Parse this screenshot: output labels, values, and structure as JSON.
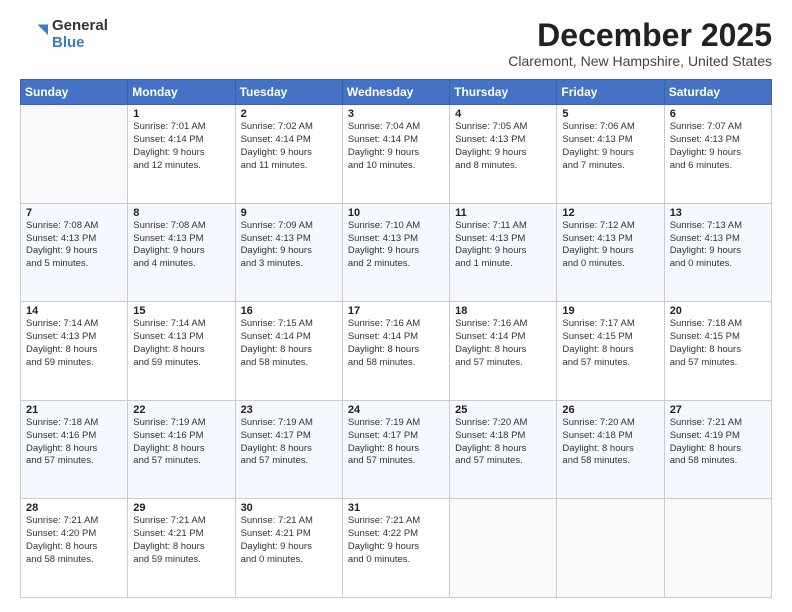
{
  "logo": {
    "general": "General",
    "blue": "Blue"
  },
  "title": {
    "month": "December 2025",
    "location": "Claremont, New Hampshire, United States"
  },
  "days_of_week": [
    "Sunday",
    "Monday",
    "Tuesday",
    "Wednesday",
    "Thursday",
    "Friday",
    "Saturday"
  ],
  "weeks": [
    [
      {
        "day": "",
        "info": ""
      },
      {
        "day": "1",
        "info": "Sunrise: 7:01 AM\nSunset: 4:14 PM\nDaylight: 9 hours\nand 12 minutes."
      },
      {
        "day": "2",
        "info": "Sunrise: 7:02 AM\nSunset: 4:14 PM\nDaylight: 9 hours\nand 11 minutes."
      },
      {
        "day": "3",
        "info": "Sunrise: 7:04 AM\nSunset: 4:14 PM\nDaylight: 9 hours\nand 10 minutes."
      },
      {
        "day": "4",
        "info": "Sunrise: 7:05 AM\nSunset: 4:13 PM\nDaylight: 9 hours\nand 8 minutes."
      },
      {
        "day": "5",
        "info": "Sunrise: 7:06 AM\nSunset: 4:13 PM\nDaylight: 9 hours\nand 7 minutes."
      },
      {
        "day": "6",
        "info": "Sunrise: 7:07 AM\nSunset: 4:13 PM\nDaylight: 9 hours\nand 6 minutes."
      }
    ],
    [
      {
        "day": "7",
        "info": "Sunrise: 7:08 AM\nSunset: 4:13 PM\nDaylight: 9 hours\nand 5 minutes."
      },
      {
        "day": "8",
        "info": "Sunrise: 7:08 AM\nSunset: 4:13 PM\nDaylight: 9 hours\nand 4 minutes."
      },
      {
        "day": "9",
        "info": "Sunrise: 7:09 AM\nSunset: 4:13 PM\nDaylight: 9 hours\nand 3 minutes."
      },
      {
        "day": "10",
        "info": "Sunrise: 7:10 AM\nSunset: 4:13 PM\nDaylight: 9 hours\nand 2 minutes."
      },
      {
        "day": "11",
        "info": "Sunrise: 7:11 AM\nSunset: 4:13 PM\nDaylight: 9 hours\nand 1 minute."
      },
      {
        "day": "12",
        "info": "Sunrise: 7:12 AM\nSunset: 4:13 PM\nDaylight: 9 hours\nand 0 minutes."
      },
      {
        "day": "13",
        "info": "Sunrise: 7:13 AM\nSunset: 4:13 PM\nDaylight: 9 hours\nand 0 minutes."
      }
    ],
    [
      {
        "day": "14",
        "info": "Sunrise: 7:14 AM\nSunset: 4:13 PM\nDaylight: 8 hours\nand 59 minutes."
      },
      {
        "day": "15",
        "info": "Sunrise: 7:14 AM\nSunset: 4:13 PM\nDaylight: 8 hours\nand 59 minutes."
      },
      {
        "day": "16",
        "info": "Sunrise: 7:15 AM\nSunset: 4:14 PM\nDaylight: 8 hours\nand 58 minutes."
      },
      {
        "day": "17",
        "info": "Sunrise: 7:16 AM\nSunset: 4:14 PM\nDaylight: 8 hours\nand 58 minutes."
      },
      {
        "day": "18",
        "info": "Sunrise: 7:16 AM\nSunset: 4:14 PM\nDaylight: 8 hours\nand 57 minutes."
      },
      {
        "day": "19",
        "info": "Sunrise: 7:17 AM\nSunset: 4:15 PM\nDaylight: 8 hours\nand 57 minutes."
      },
      {
        "day": "20",
        "info": "Sunrise: 7:18 AM\nSunset: 4:15 PM\nDaylight: 8 hours\nand 57 minutes."
      }
    ],
    [
      {
        "day": "21",
        "info": "Sunrise: 7:18 AM\nSunset: 4:16 PM\nDaylight: 8 hours\nand 57 minutes."
      },
      {
        "day": "22",
        "info": "Sunrise: 7:19 AM\nSunset: 4:16 PM\nDaylight: 8 hours\nand 57 minutes."
      },
      {
        "day": "23",
        "info": "Sunrise: 7:19 AM\nSunset: 4:17 PM\nDaylight: 8 hours\nand 57 minutes."
      },
      {
        "day": "24",
        "info": "Sunrise: 7:19 AM\nSunset: 4:17 PM\nDaylight: 8 hours\nand 57 minutes."
      },
      {
        "day": "25",
        "info": "Sunrise: 7:20 AM\nSunset: 4:18 PM\nDaylight: 8 hours\nand 57 minutes."
      },
      {
        "day": "26",
        "info": "Sunrise: 7:20 AM\nSunset: 4:18 PM\nDaylight: 8 hours\nand 58 minutes."
      },
      {
        "day": "27",
        "info": "Sunrise: 7:21 AM\nSunset: 4:19 PM\nDaylight: 8 hours\nand 58 minutes."
      }
    ],
    [
      {
        "day": "28",
        "info": "Sunrise: 7:21 AM\nSunset: 4:20 PM\nDaylight: 8 hours\nand 58 minutes."
      },
      {
        "day": "29",
        "info": "Sunrise: 7:21 AM\nSunset: 4:21 PM\nDaylight: 8 hours\nand 59 minutes."
      },
      {
        "day": "30",
        "info": "Sunrise: 7:21 AM\nSunset: 4:21 PM\nDaylight: 9 hours\nand 0 minutes."
      },
      {
        "day": "31",
        "info": "Sunrise: 7:21 AM\nSunset: 4:22 PM\nDaylight: 9 hours\nand 0 minutes."
      },
      {
        "day": "",
        "info": ""
      },
      {
        "day": "",
        "info": ""
      },
      {
        "day": "",
        "info": ""
      }
    ]
  ]
}
